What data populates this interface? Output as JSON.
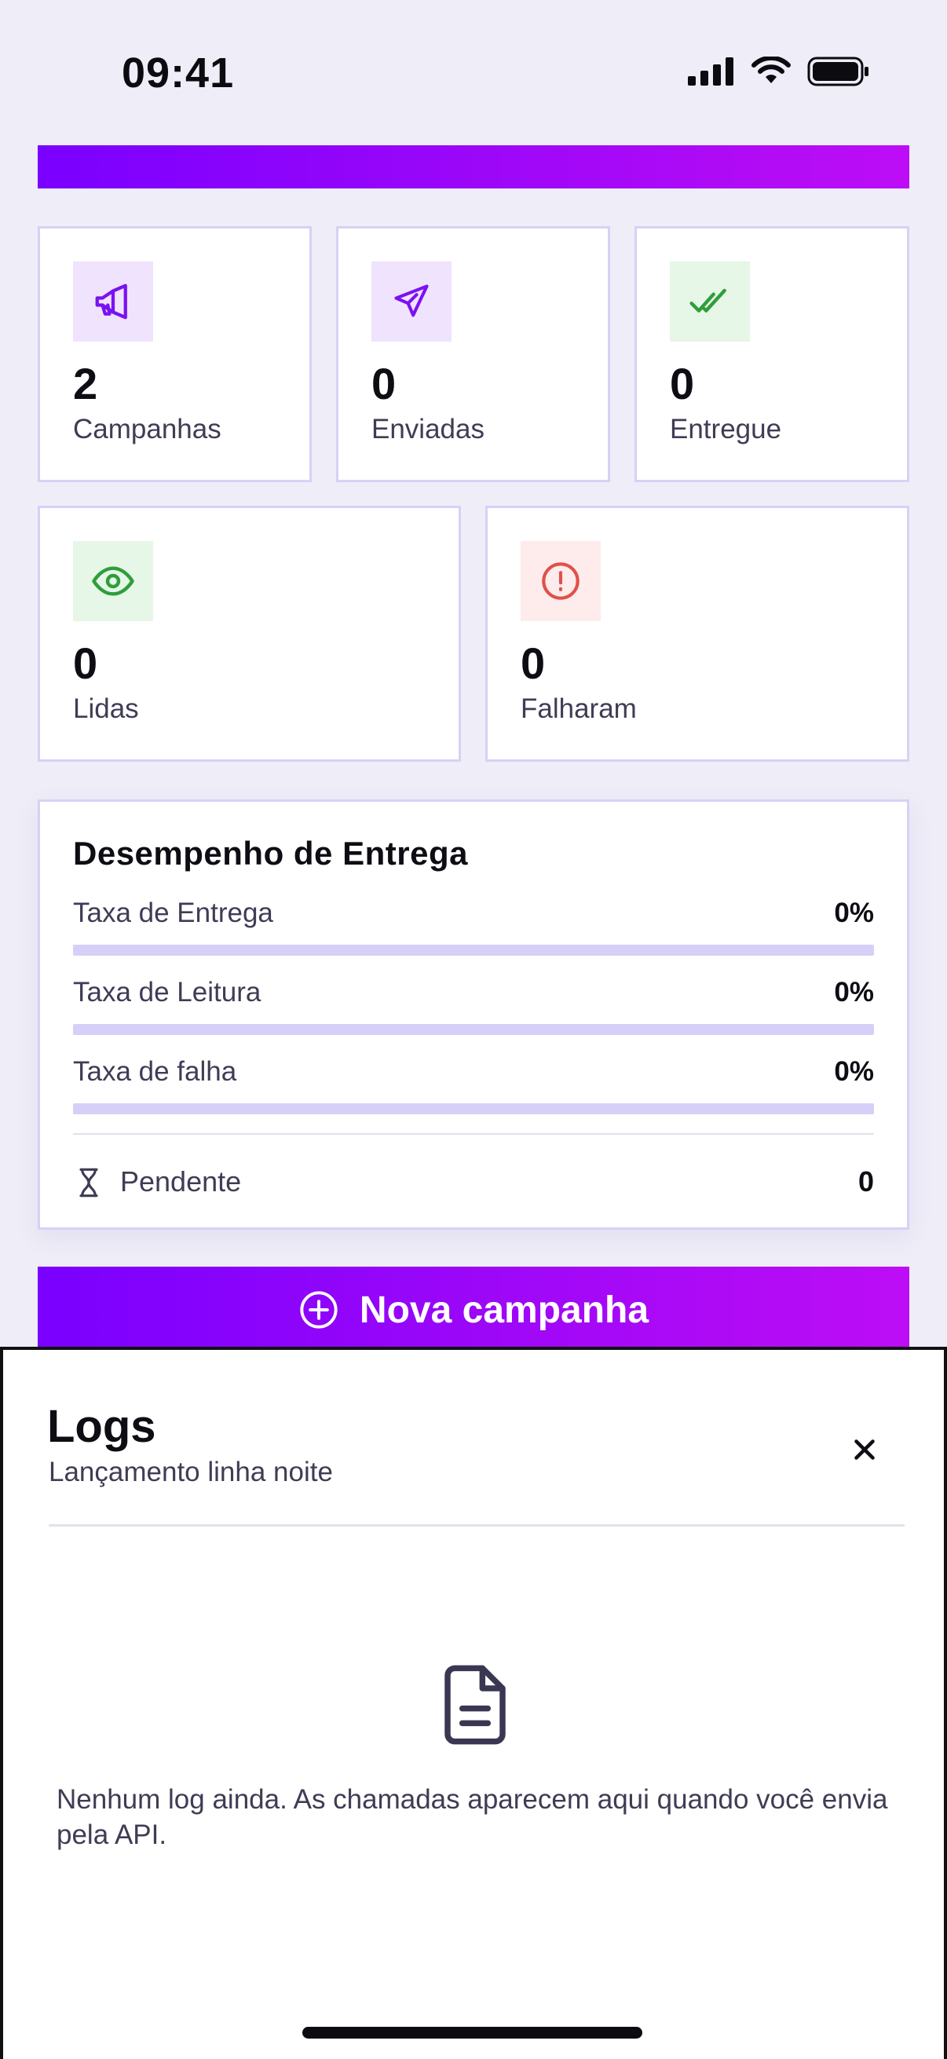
{
  "status_bar": {
    "time": "09:41",
    "icons": [
      "cellular-signal-icon",
      "wifi-icon",
      "battery-icon"
    ]
  },
  "colors": {
    "accent_gradient_start": "#7a00ff",
    "accent_gradient_end": "#bd0df6",
    "card_border": "#d7d1f6",
    "success": "#2e9e3b",
    "danger": "#e0504a",
    "track": "#d6cff8"
  },
  "stats": [
    {
      "value": "2",
      "label": "Campanhas",
      "icon": "megaphone-icon"
    },
    {
      "value": "0",
      "label": "Enviadas",
      "icon": "send-icon"
    },
    {
      "value": "0",
      "label": "Entregue",
      "icon": "double-check-icon"
    },
    {
      "value": "0",
      "label": "Lidas",
      "icon": "eye-icon"
    },
    {
      "value": "0",
      "label": "Falharam",
      "icon": "alert-circle-icon"
    }
  ],
  "performance": {
    "title": "Desempenho de Entrega",
    "metrics": [
      {
        "label": "Taxa de Entrega",
        "value": "0%",
        "fraction": 0
      },
      {
        "label": "Taxa de Leitura",
        "value": "0%",
        "fraction": 0
      },
      {
        "label": "Taxa de falha",
        "value": "0%",
        "fraction": 0
      }
    ],
    "pending": {
      "label": "Pendente",
      "value": "0",
      "icon": "hourglass-icon"
    }
  },
  "new_campaign_button": {
    "label": "Nova campanha",
    "icon": "plus-circle-icon"
  },
  "logs_sheet": {
    "title": "Logs",
    "subtitle": "Lançamento linha noite",
    "close_icon": "close-icon",
    "empty_icon": "document-icon",
    "empty_text": "Nenhum log ainda. As chamadas aparecem aqui quando você envia pela API."
  }
}
